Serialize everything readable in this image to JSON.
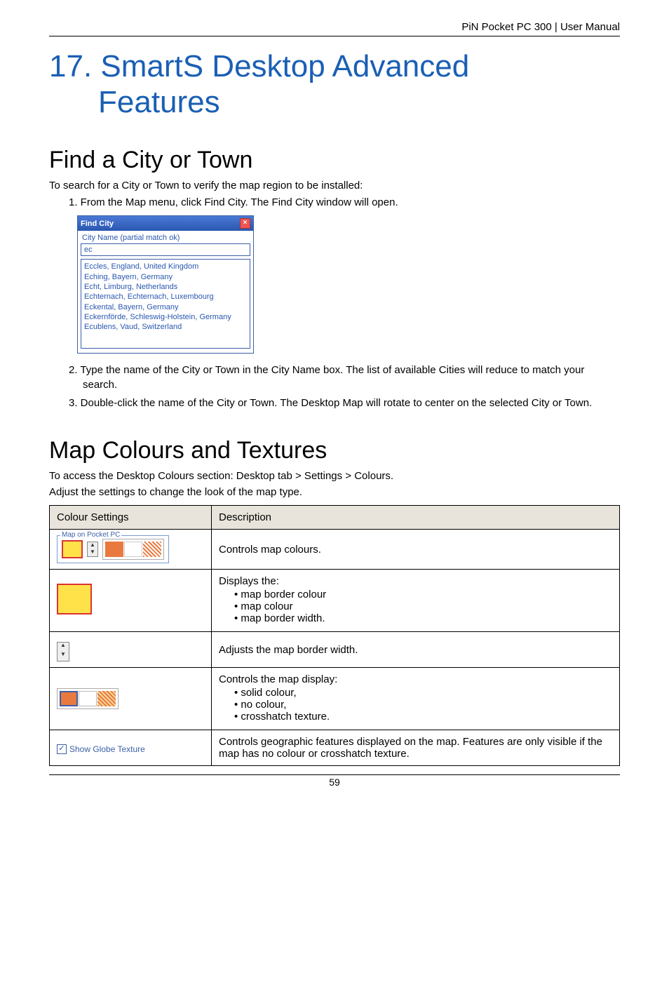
{
  "header": {
    "right": "PiN Pocket PC 300 | User Manual"
  },
  "title": {
    "line1": "17. SmartS Desktop Advanced",
    "line2": "Features"
  },
  "section1": {
    "heading": "Find a City or Town",
    "intro": "To search for a City or Town to verify the map region to be installed:",
    "step1": "1. From the Map menu, click Find City. The Find City window will open.",
    "step2": "2. Type the name of the City or Town in the City Name box. The list of available Cities will reduce to match your search.",
    "step3": "3. Double-click the name of the City or Town. The Desktop Map will rotate to center on the selected City or Town."
  },
  "findCityDialog": {
    "title": "Find City",
    "label": "City Name (partial match ok)",
    "inputValue": "ec",
    "results": [
      "Eccles, England, United Kingdom",
      "Eching, Bayern, Germany",
      "Echt, Limburg, Netherlands",
      "Echternach, Echternach, Luxembourg",
      "Eckental, Bayern, Germany",
      "Eckernförde, Schleswig-Holstein, Germany",
      "Ecublens, Vaud, Switzerland"
    ]
  },
  "section2": {
    "heading": "Map Colours and Textures",
    "intro1": "To access the Desktop Colours section: Desktop tab > Settings > Colours.",
    "intro2": "Adjust the settings to change the look of the map type."
  },
  "table": {
    "header1": "Colour Settings",
    "header2": "Description",
    "row1": {
      "widgetLegend": "Map on Pocket PC",
      "desc": "Controls map colours."
    },
    "row2": {
      "desc_line": "Displays the:",
      "b1": "map border colour",
      "b2": "map colour",
      "b3": "map border width."
    },
    "row3": {
      "desc": "Adjusts the map border width."
    },
    "row4": {
      "desc_line": "Controls the map display:",
      "b1": "solid colour,",
      "b2": "no colour,",
      "b3": "crosshatch texture."
    },
    "row5": {
      "checkboxLabel": "Show Globe Texture",
      "desc": "Controls geographic features displayed on the map. Features are only visible if the map has no colour or crosshatch texture."
    }
  },
  "footer": {
    "pageNumber": "59"
  }
}
